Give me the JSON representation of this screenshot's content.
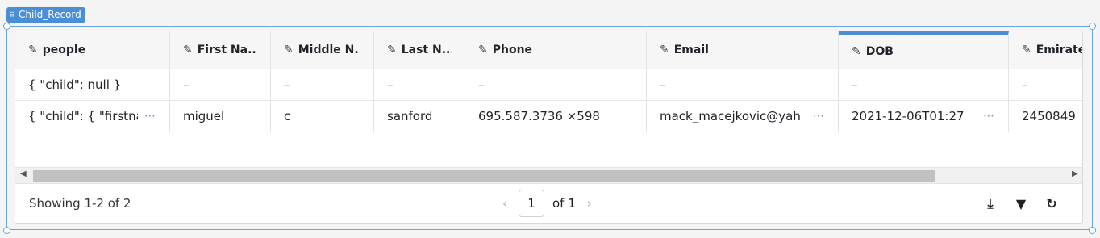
{
  "widget": {
    "name": "Child_Record"
  },
  "columns": [
    {
      "label": "people"
    },
    {
      "label": "First Na..."
    },
    {
      "label": "Middle N..."
    },
    {
      "label": "Last N..."
    },
    {
      "label": "Phone"
    },
    {
      "label": "Email"
    },
    {
      "label": "DOB"
    },
    {
      "label": "Emirate"
    }
  ],
  "rows": [
    {
      "cells": [
        "{ \"child\": null }",
        "–",
        "–",
        "–",
        "–",
        "–",
        "–",
        "–"
      ]
    },
    {
      "cells": [
        "{ \"child\": { \"firstna",
        "miguel",
        "c",
        "sanford",
        "695.587.3736 ×598",
        "mack_macejkovic@yah",
        "2021-12-06T01:27",
        "2450849"
      ]
    }
  ],
  "footer": {
    "showing": "Showing 1-2 of 2",
    "page_current": "1",
    "page_of": "of 1"
  },
  "icons": {
    "edit": "pencil-icon",
    "download": "download-icon",
    "filter": "filter-icon",
    "refresh": "refresh-icon"
  },
  "colors": {
    "accent": "#4a8fd6",
    "selection": "#6aa2e0"
  }
}
